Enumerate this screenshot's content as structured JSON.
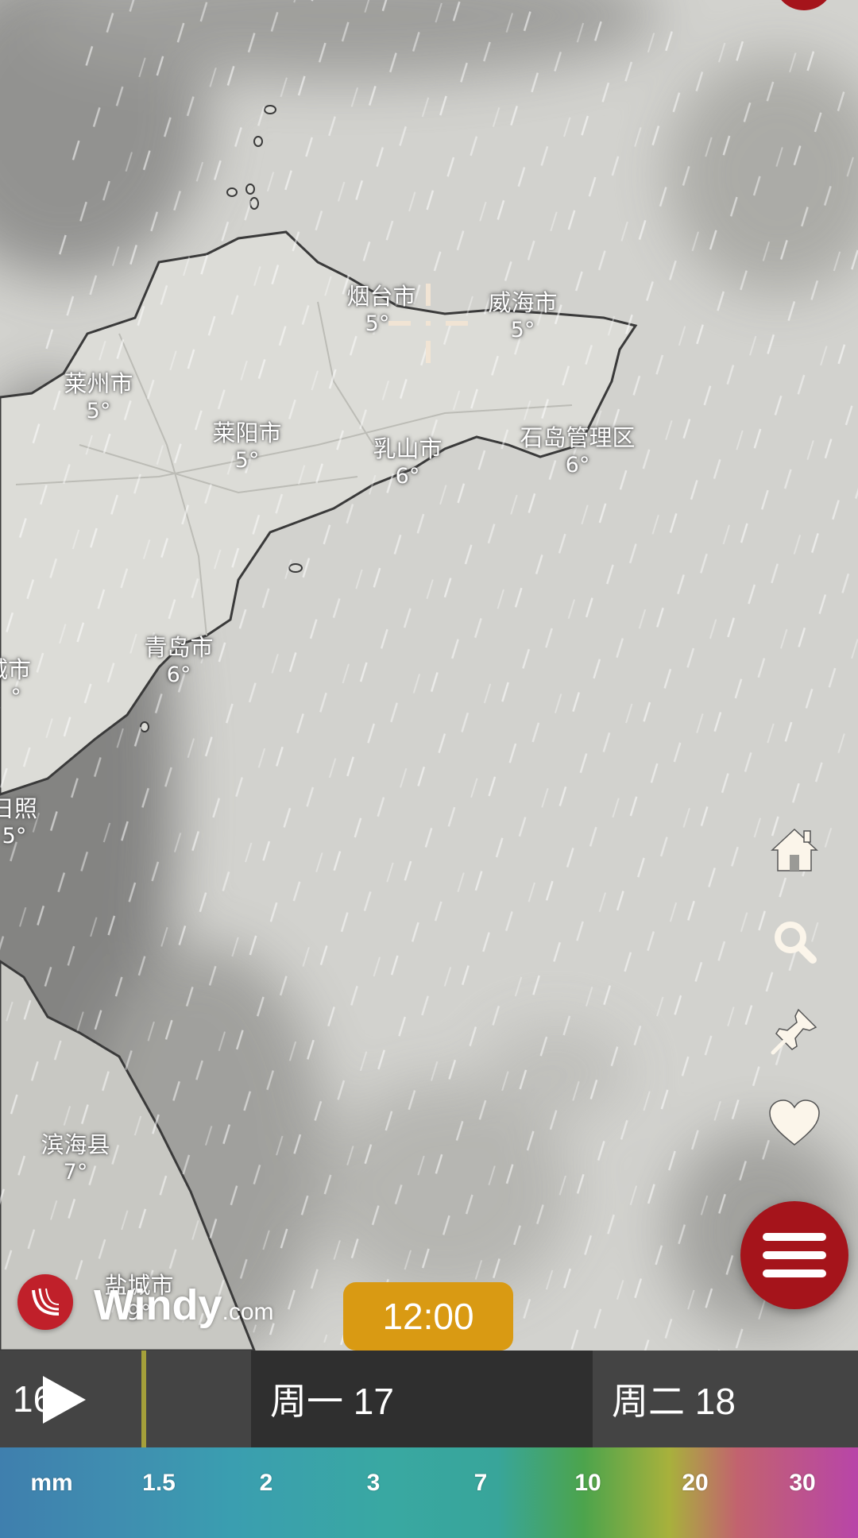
{
  "map": {
    "cities": [
      {
        "name": "烟台市",
        "temp": "5°"
      },
      {
        "name": "威海市",
        "temp": "5°"
      },
      {
        "name": "莱州市",
        "temp": "5°"
      },
      {
        "name": "莱阳市",
        "temp": "5°"
      },
      {
        "name": "乳山市",
        "temp": "6°"
      },
      {
        "name": "石岛管理区",
        "temp": "6°"
      },
      {
        "name": "青岛市",
        "temp": "6°"
      },
      {
        "name": "城市",
        "temp": "°"
      },
      {
        "name": "日照",
        "temp": "5°"
      },
      {
        "name": "滨海县",
        "temp": "7°"
      },
      {
        "name": "盐城市",
        "temp": "9°"
      }
    ]
  },
  "brand": {
    "name": "Windy",
    "suffix": ".com",
    "logo_color": "#c0202a"
  },
  "side_controls": {
    "icons": [
      "home-icon",
      "search-icon",
      "pin-icon",
      "heart-icon"
    ],
    "menu_color": "#a5141b"
  },
  "timeline": {
    "current_time": "12:00",
    "partial_day": "16",
    "days": [
      "周一 17",
      "周二 18"
    ],
    "badge_color": "#d99a13"
  },
  "legend": {
    "unit": "mm",
    "values": [
      "1.5",
      "2",
      "3",
      "7",
      "10",
      "20",
      "30"
    ]
  }
}
